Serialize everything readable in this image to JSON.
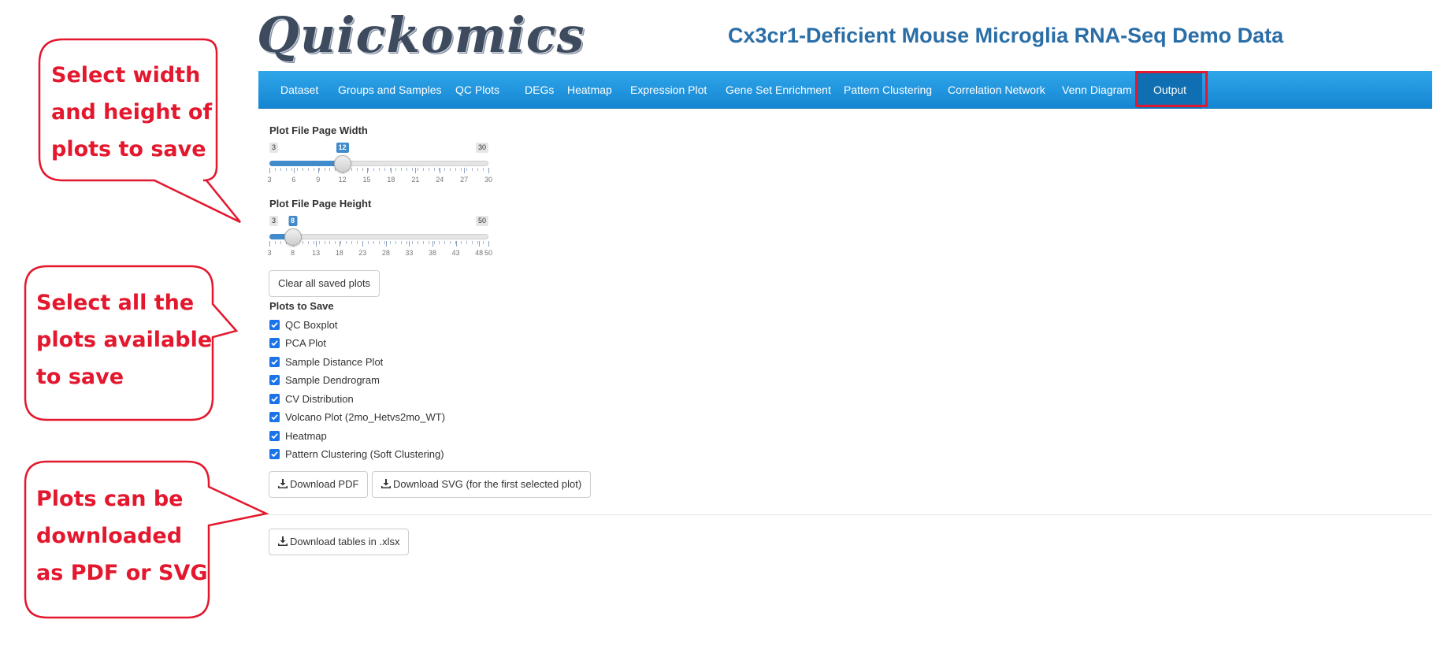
{
  "header": {
    "logo_text": "Quickomics",
    "title": "Cx3cr1-Deficient Mouse Microglia RNA-Seq Demo Data"
  },
  "nav": {
    "items": [
      {
        "label": "Dataset"
      },
      {
        "label": "Groups and Samples"
      },
      {
        "label": "QC Plots"
      },
      {
        "label": "DEGs"
      },
      {
        "label": "Heatmap"
      },
      {
        "label": "Expression Plot"
      },
      {
        "label": "Gene Set Enrichment"
      },
      {
        "label": "Pattern Clustering"
      },
      {
        "label": "Correlation Network"
      },
      {
        "label": "Venn Diagram"
      },
      {
        "label": "Output"
      }
    ],
    "active": "Output"
  },
  "sliders": {
    "width": {
      "label": "Plot File Page Width",
      "min": 3,
      "max": 30,
      "value": 12,
      "min_label": "3",
      "max_label": "30",
      "value_label": "12",
      "tick_labels": [
        "3",
        "6",
        "9",
        "12",
        "15",
        "18",
        "21",
        "24",
        "27",
        "30"
      ]
    },
    "height": {
      "label": "Plot File Page Height",
      "min": 3,
      "max": 50,
      "value": 8,
      "min_label": "3",
      "max_label": "50",
      "value_label": "8",
      "tick_labels": [
        "3",
        "8",
        "13",
        "18",
        "23",
        "28",
        "33",
        "38",
        "43",
        "48",
        "50"
      ]
    }
  },
  "buttons": {
    "clear_label": "Clear all saved plots",
    "download_pdf": "Download PDF",
    "download_svg": "Download SVG (for the first selected plot)",
    "download_xlsx": "Download tables in .xlsx"
  },
  "plots_to_save": {
    "label": "Plots to Save",
    "items": [
      {
        "label": "QC Boxplot",
        "checked": true
      },
      {
        "label": "PCA Plot",
        "checked": true
      },
      {
        "label": "Sample Distance Plot",
        "checked": true
      },
      {
        "label": "Sample Dendrogram",
        "checked": true
      },
      {
        "label": "CV Distribution",
        "checked": true
      },
      {
        "label": "Volcano Plot (2mo_Hetvs2mo_WT)",
        "checked": true
      },
      {
        "label": "Heatmap",
        "checked": true
      },
      {
        "label": "Pattern Clustering (Soft Clustering)",
        "checked": true
      }
    ]
  },
  "callouts": {
    "sizes": {
      "lines": [
        "Select width",
        "and height of",
        "plots to save"
      ]
    },
    "select": {
      "lines": [
        "Select all the",
        "plots available",
        "to save"
      ]
    },
    "download": {
      "lines": [
        "Plots can be",
        "downloaded",
        "as PDF or SVG"
      ]
    }
  },
  "colors": {
    "accent": "#1586d2",
    "callout_red": "#e3172d",
    "title_blue": "#2a6ea7",
    "slider_blue": "#428bca"
  }
}
